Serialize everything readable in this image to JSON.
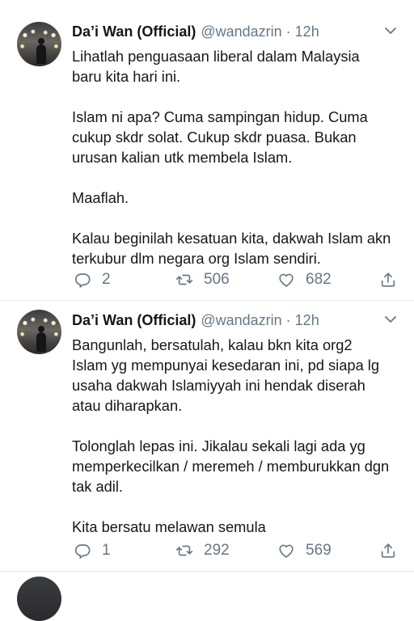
{
  "tweets": [
    {
      "display_name": "Da’i Wan (Official)",
      "handle": "@wandazrin",
      "separator": "·",
      "time": "12h",
      "paragraphs": [
        "Lihatlah penguasaan liberal dalam Malaysia baru kita hari ini.",
        "Islam ni apa? Cuma sampingan hidup. Cuma cukup skdr solat. Cukup skdr puasa. Bukan urusan kalian utk membela Islam.",
        "Maaflah.",
        "Kalau beginilah kesatuan kita, dakwah Islam akn terkubur dlm negara org Islam sendiri."
      ],
      "replies": "2",
      "retweets": "506",
      "likes": "682"
    },
    {
      "display_name": "Da’i Wan (Official)",
      "handle": "@wandazrin",
      "separator": "·",
      "time": "12h",
      "paragraphs": [
        "Bangunlah, bersatulah, kalau bkn kita org2 Islam yg mempunyai kesedaran ini, pd siapa lg usaha dakwah Islamiyyah ini hendak diserah atau diharapkan.",
        "Tolonglah lepas ini. Jikalau sekali lagi ada yg memperkecilkan / meremeh / memburukkan dgn tak adil.",
        "Kita bersatu melawan semula"
      ],
      "replies": "1",
      "retweets": "292",
      "likes": "569"
    }
  ],
  "icons": {
    "reply": "reply-icon",
    "retweet": "retweet-icon",
    "like": "heart-icon",
    "share": "share-icon",
    "menu": "chevron-down-icon"
  },
  "colors": {
    "text": "#14171a",
    "secondary": "#657786",
    "divider": "#e6ecf0"
  }
}
